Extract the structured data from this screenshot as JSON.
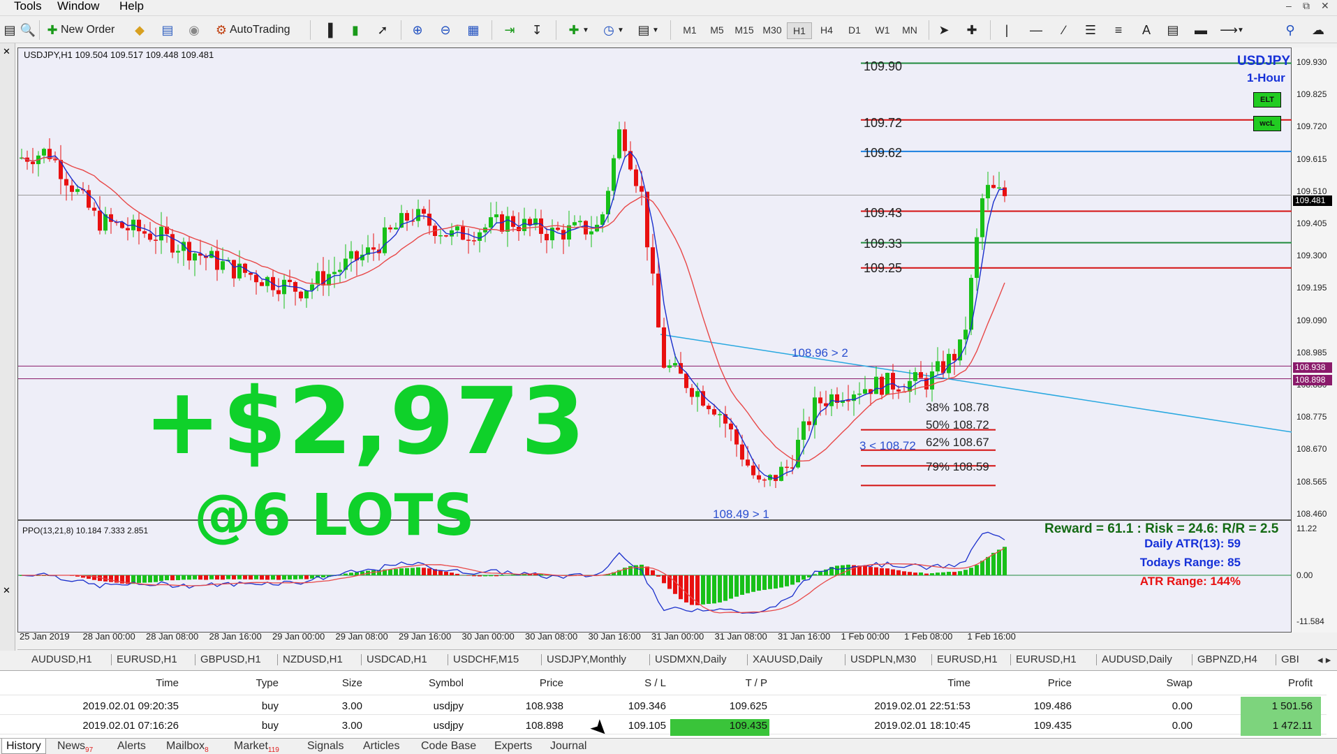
{
  "menu": [
    "Tools",
    "Window",
    "Help"
  ],
  "toolbar": {
    "new_order": "New Order",
    "autotrading": "AutoTrading",
    "timeframes": [
      "M1",
      "M5",
      "M15",
      "M30",
      "H1",
      "H4",
      "D1",
      "W1",
      "MN"
    ],
    "selected_timeframe": "H1"
  },
  "chart": {
    "title": "USDJPY,H1  109.504 109.517 109.448 109.481",
    "symbol_badge": "USDJPY",
    "timeframe_badge": "1-Hour",
    "badge_elt": "ELT",
    "badge_wcl": "wcL",
    "big_profit": "+$2,973",
    "big_lots": "@6 LOTS",
    "levels": [
      {
        "label": "109.90",
        "price": 109.9,
        "color": "#1e8a3c"
      },
      {
        "label": "109.72",
        "price": 109.72,
        "color": "#d41010"
      },
      {
        "label": "109.62",
        "price": 109.62,
        "color": "#1a7fe0"
      },
      {
        "label": "109.43",
        "price": 109.43,
        "color": "#d41010"
      },
      {
        "label": "109.33",
        "price": 109.33,
        "color": "#1e8a3c"
      },
      {
        "label": "109.25",
        "price": 109.25,
        "color": "#d41010"
      }
    ],
    "fib": [
      {
        "label": "38% 108.78",
        "price": 108.78
      },
      {
        "label": "50% 108.72",
        "price": 108.72
      },
      {
        "label": "62% 108.67",
        "price": 108.67
      },
      {
        "label": "79% 108.59",
        "price": 108.59
      }
    ],
    "annotations": {
      "trend_label": "108.96 > 2",
      "low_label": "108.49 > 1",
      "entry_label": "3 < 108.72"
    },
    "reward_risk": "Reward = 61.1 : Risk = 24.6: R/R = 2.5",
    "price_axis": [
      "109.930",
      "109.825",
      "109.720",
      "109.615",
      "109.510",
      "109.405",
      "109.300",
      "109.195",
      "109.090",
      "108.985",
      "108.880",
      "108.775",
      "108.670",
      "108.565",
      "108.460"
    ],
    "price_tags": [
      {
        "label": "109.481",
        "color": "#000000"
      },
      {
        "label": "108.938",
        "color": "#8a1a6a"
      },
      {
        "label": "108.898",
        "color": "#8a1a6a"
      }
    ],
    "ppo_title": "PPO(13,21,8) 10.184 7.333 2.851",
    "ppo_axis": [
      "11.22",
      "0.00",
      "-11.584"
    ],
    "atr_daily": "Daily ATR(13): 59",
    "todays_range": "Todays Range: 85",
    "atr_range": "ATR Range: 144%",
    "time_axis": [
      "25 Jan 2019",
      "28 Jan 00:00",
      "28 Jan 08:00",
      "28 Jan 16:00",
      "29 Jan 00:00",
      "29 Jan 08:00",
      "29 Jan 16:00",
      "30 Jan 00:00",
      "30 Jan 08:00",
      "30 Jan 16:00",
      "31 Jan 00:00",
      "31 Jan 08:00",
      "31 Jan 16:00",
      "1 Feb 00:00",
      "1 Feb 08:00",
      "1 Feb 16:00"
    ]
  },
  "symbol_tabs": [
    "AUDUSD,H1",
    "EURUSD,H1",
    "GBPUSD,H1",
    "NZDUSD,H1",
    "USDCAD,H1",
    "USDCHF,M15",
    "USDJPY,Monthly",
    "USDMXN,Daily",
    "XAUUSD,Daily",
    "USDPLN,M30",
    "EURUSD,H1",
    "EURUSD,H1",
    "AUDUSD,Daily",
    "GBPNZD,H4",
    "GBI"
  ],
  "history": {
    "columns": [
      "Time",
      "Type",
      "Size",
      "Symbol",
      "Price",
      "S / L",
      "T / P",
      "Time",
      "Price",
      "Swap",
      "Profit"
    ],
    "rows": [
      [
        "2019.02.01 09:20:35",
        "buy",
        "3.00",
        "usdjpy",
        "108.938",
        "109.346",
        "109.625",
        "2019.02.01 22:51:53",
        "109.486",
        "0.00",
        "1 501.56"
      ],
      [
        "2019.02.01 07:16:26",
        "buy",
        "3.00",
        "usdjpy",
        "108.898",
        "109.105",
        "109.435",
        "2019.02.01 18:10:45",
        "109.435",
        "0.00",
        "1 472.11"
      ]
    ]
  },
  "bottom_tabs": [
    {
      "label": "History",
      "badge": ""
    },
    {
      "label": "News",
      "badge": "97"
    },
    {
      "label": "Alerts",
      "badge": ""
    },
    {
      "label": "Mailbox",
      "badge": "8"
    },
    {
      "label": "Market",
      "badge": "119"
    },
    {
      "label": "Signals",
      "badge": ""
    },
    {
      "label": "Articles",
      "badge": ""
    },
    {
      "label": "Code Base",
      "badge": ""
    },
    {
      "label": "Experts",
      "badge": ""
    },
    {
      "label": "Journal",
      "badge": ""
    }
  ],
  "colors": {
    "profit_green": "#0fd12a",
    "bull": "#18c018",
    "bear": "#e81010",
    "ma_fast": "#1a2fcc",
    "ma_slow": "#e84848"
  }
}
